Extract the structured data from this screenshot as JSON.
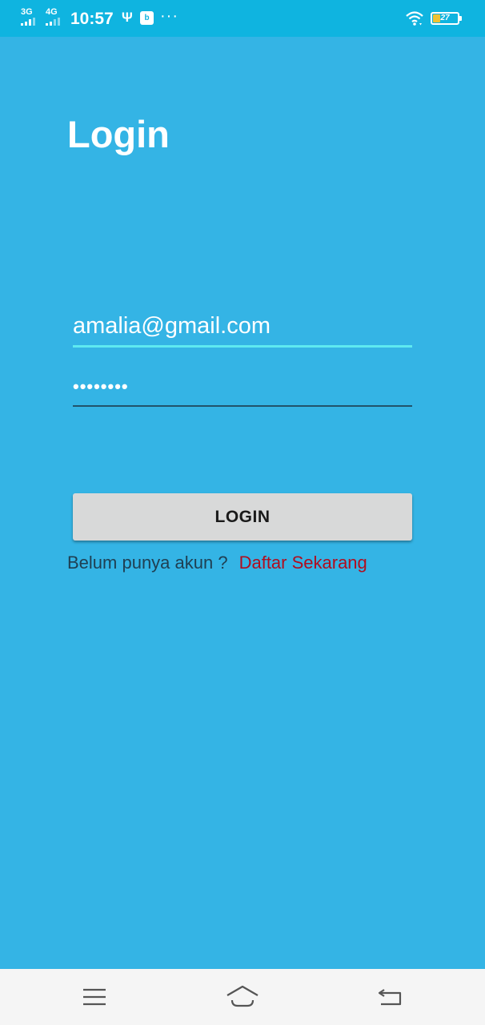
{
  "status_bar": {
    "signal_1_label": "3G",
    "signal_2_label": "4G",
    "time": "10:57",
    "battery_level": "27"
  },
  "login": {
    "title": "Login",
    "email_value": "amalia@gmail.com",
    "password_value": "••••••••",
    "login_button_label": "LOGIN",
    "signup_question": "Belum punya akun ?",
    "signup_link": "Daftar Sekarang"
  },
  "nav_bar": {
    "items": [
      "menu-icon",
      "home-icon",
      "back-icon"
    ]
  },
  "colors": {
    "background": "#34b4e5",
    "status_bar": "#0fb4e0",
    "link": "#b00d1f",
    "email_underline": "#5eeaf0",
    "button": "#d8d9d9"
  }
}
